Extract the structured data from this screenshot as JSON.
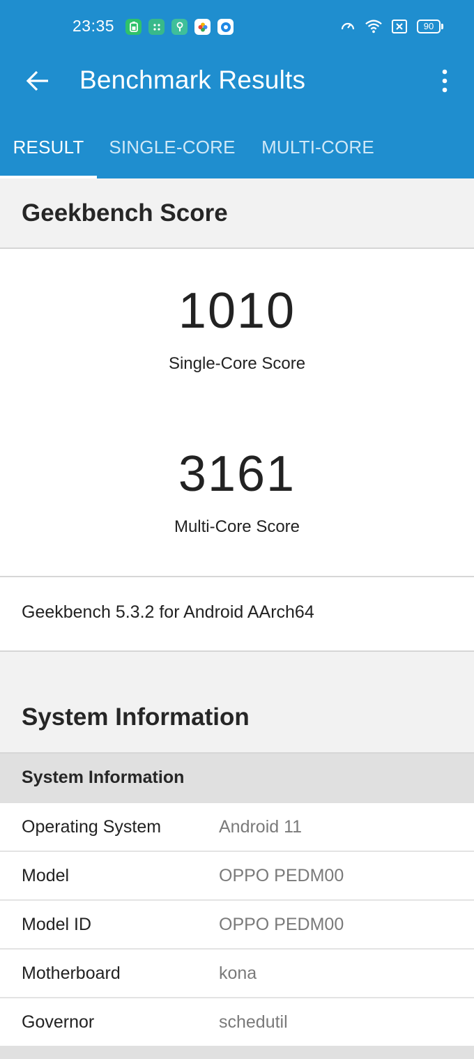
{
  "status_bar": {
    "time": "23:35",
    "apps": [
      {
        "icon": "battery-saver-app-icon",
        "glyph": "▯",
        "color": "#2fc26b"
      },
      {
        "icon": "dial-app-icon",
        "glyph": "⁝",
        "color": "#38b98a"
      },
      {
        "icon": "keyboard-app-icon",
        "glyph": "⍊",
        "color": "#3fbf9a"
      },
      {
        "icon": "photos-app-icon",
        "glyph": "✿",
        "color": "#ffffff"
      },
      {
        "icon": "browser-app-icon",
        "glyph": "●",
        "color": "#ffffff"
      }
    ],
    "battery": "90"
  },
  "toolbar": {
    "title": "Benchmark Results"
  },
  "tabs": [
    {
      "label": "RESULT",
      "active": true
    },
    {
      "label": "SINGLE-CORE",
      "active": false
    },
    {
      "label": "MULTI-CORE",
      "active": false
    }
  ],
  "geekbench": {
    "heading": "Geekbench Score",
    "single_core_score": "1010",
    "single_core_label": "Single-Core Score",
    "multi_core_score": "3161",
    "multi_core_label": "Multi-Core Score",
    "version": "Geekbench 5.3.2 for Android AArch64"
  },
  "system": {
    "heading": "System Information",
    "subheading": "System Information",
    "rows": [
      {
        "key": "Operating System",
        "value": "Android 11"
      },
      {
        "key": "Model",
        "value": "OPPO PEDM00"
      },
      {
        "key": "Model ID",
        "value": "OPPO PEDM00"
      },
      {
        "key": "Motherboard",
        "value": "kona"
      },
      {
        "key": "Governor",
        "value": "schedutil"
      }
    ]
  },
  "colors": {
    "app_bar": "#1f8ecf",
    "section_bg": "#f2f2f2",
    "subheader_bg": "#e0e0e0"
  }
}
